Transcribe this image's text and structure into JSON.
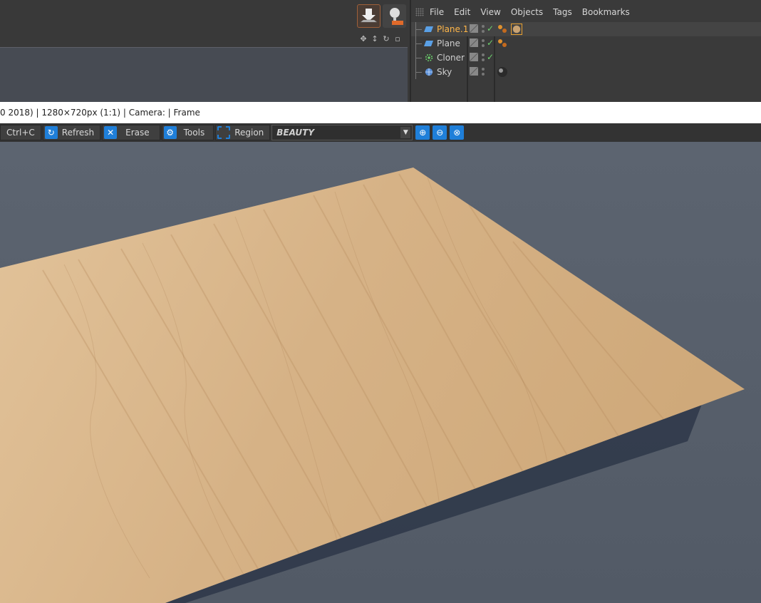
{
  "object_manager": {
    "menu": [
      "File",
      "Edit",
      "View",
      "Objects",
      "Tags",
      "Bookmarks"
    ],
    "objects": [
      {
        "name": "Plane.1",
        "icon": "plane-icon",
        "selected": true
      },
      {
        "name": "Plane",
        "icon": "plane-icon",
        "selected": false
      },
      {
        "name": "Cloner",
        "icon": "cloner-icon",
        "selected": false
      },
      {
        "name": "Sky",
        "icon": "sky-icon",
        "selected": false
      }
    ]
  },
  "render": {
    "status_text": "0 2018) | 1280×720px (1:1) | Camera:  | Frame",
    "toolbar": {
      "copy_label": "Ctrl+C",
      "refresh_label": "Refresh",
      "erase_label": "Erase",
      "tools_label": "Tools",
      "region_label": "Region",
      "layer_value": "BEAUTY"
    }
  },
  "colors": {
    "accent": "#1f7fd9",
    "selection": "#ffb648",
    "wood": "#d7b58a",
    "background": "#5c6470"
  }
}
